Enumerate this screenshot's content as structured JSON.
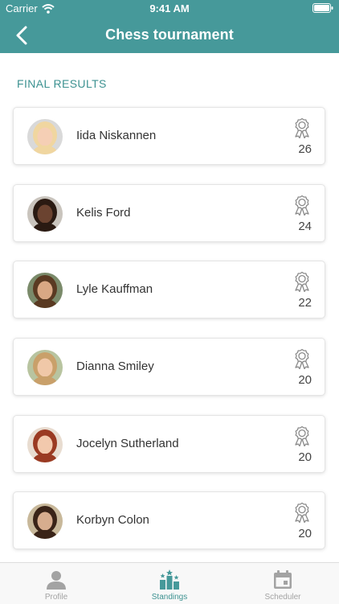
{
  "status_bar": {
    "carrier": "Carrier",
    "time": "9:41 AM"
  },
  "nav": {
    "title": "Chess tournament",
    "back_icon": "chevron-left-icon"
  },
  "section_title": "FINAL RESULTS",
  "players": [
    {
      "name": "Iida Niskannen",
      "points": "26",
      "hair": "#f0d6a0",
      "skin": "#f5cfb5",
      "bg": "#d9d9d9"
    },
    {
      "name": "Kelis Ford",
      "points": "24",
      "hair": "#2a1a12",
      "skin": "#6b4330",
      "bg": "#c9c4bd"
    },
    {
      "name": "Lyle Kauffman",
      "points": "22",
      "hair": "#5a3a22",
      "skin": "#d9a884",
      "bg": "#7a8a6a"
    },
    {
      "name": "Dianna Smiley",
      "points": "20",
      "hair": "#c9a06a",
      "skin": "#f0c8a8",
      "bg": "#b8c4a0"
    },
    {
      "name": "Jocelyn Sutherland",
      "points": "20",
      "hair": "#9a3a22",
      "skin": "#f2c9ad",
      "bg": "#e8dcd0"
    },
    {
      "name": "Korbyn Colon",
      "points": "20",
      "hair": "#3a2418",
      "skin": "#d7ad8e",
      "bg": "#c8b89a"
    }
  ],
  "tabs": [
    {
      "label": "Profile",
      "icon": "person-icon",
      "active": false
    },
    {
      "label": "Standings",
      "icon": "standings-icon",
      "active": true
    },
    {
      "label": "Scheduler",
      "icon": "calendar-icon",
      "active": false
    }
  ],
  "colors": {
    "accent": "#46999a",
    "accent_text": "#3d9291",
    "inactive": "#a3a3a3"
  }
}
